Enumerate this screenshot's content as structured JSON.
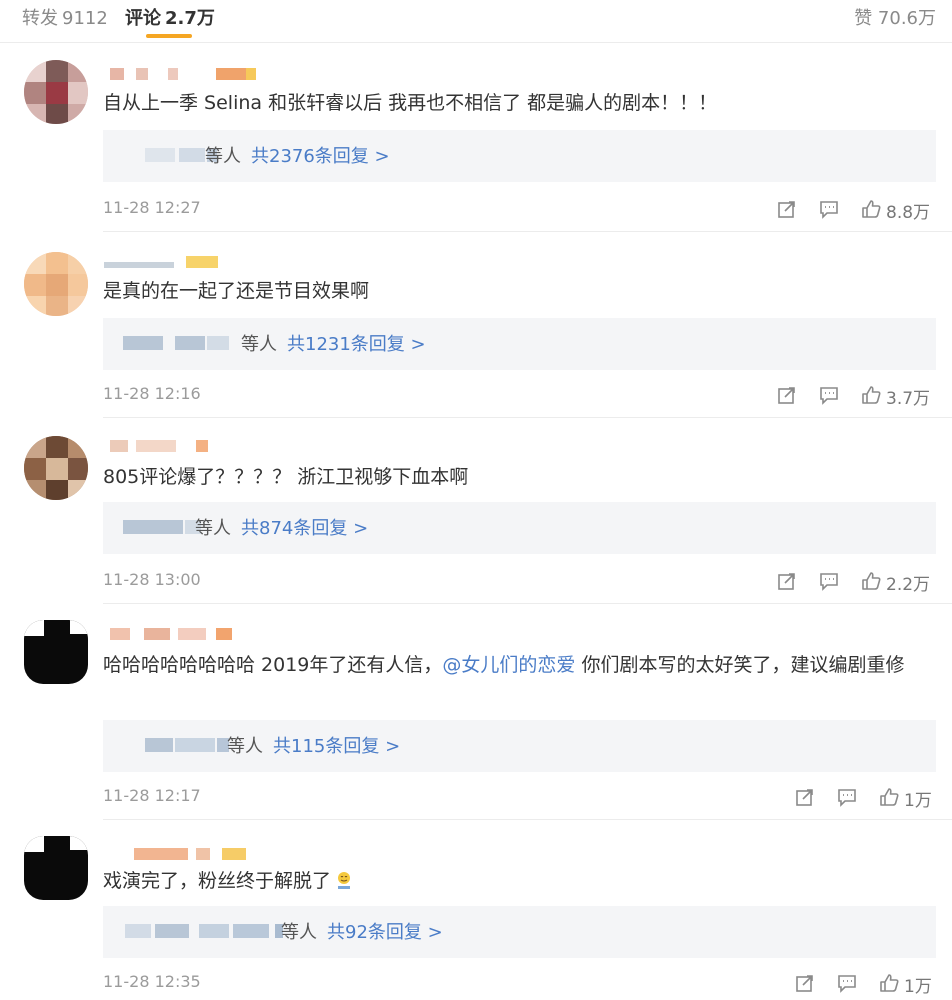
{
  "tabs": {
    "forward_label": "转发",
    "forward_count": "9112",
    "comments_label": "评论",
    "comments_count": "2.7万",
    "likes_label": "赞",
    "likes_count": "70.6万"
  },
  "colors": {
    "accent": "#f5a623",
    "link": "#4a7cc7"
  },
  "reply_suffix": "等人",
  "comments": [
    {
      "text": "自从上一季 Selina 和张轩睿以后 我再也不相信了 都是骗人的剧本！！！",
      "reply_count_text": "共2376条回复 >",
      "time": "11-28 12:27",
      "likes": "8.8万"
    },
    {
      "text": "是真的在一起了还是节目效果啊",
      "reply_count_text": "共1231条回复 >",
      "time": "11-28 12:16",
      "likes": "3.7万"
    },
    {
      "text": "805评论爆了？？？？ 浙江卫视够下血本啊",
      "reply_count_text": "共874条回复 >",
      "time": "11-28 13:00",
      "likes": "2.2万"
    },
    {
      "text_before": "哈哈哈哈哈哈哈哈 2019年了还有人信，",
      "mention": "@女儿们的恋爱",
      "text_after": " 你们剧本写的太好笑了，建议编剧重修",
      "reply_suffix": "等人",
      "reply_count_text": "共115条回复 >",
      "time": "11-28 12:17",
      "likes": "1万"
    },
    {
      "text": "戏演完了，粉丝终于解脱了",
      "reply_count_text": "共92条回复 >",
      "time": "11-28 12:35",
      "likes": "1万"
    }
  ]
}
